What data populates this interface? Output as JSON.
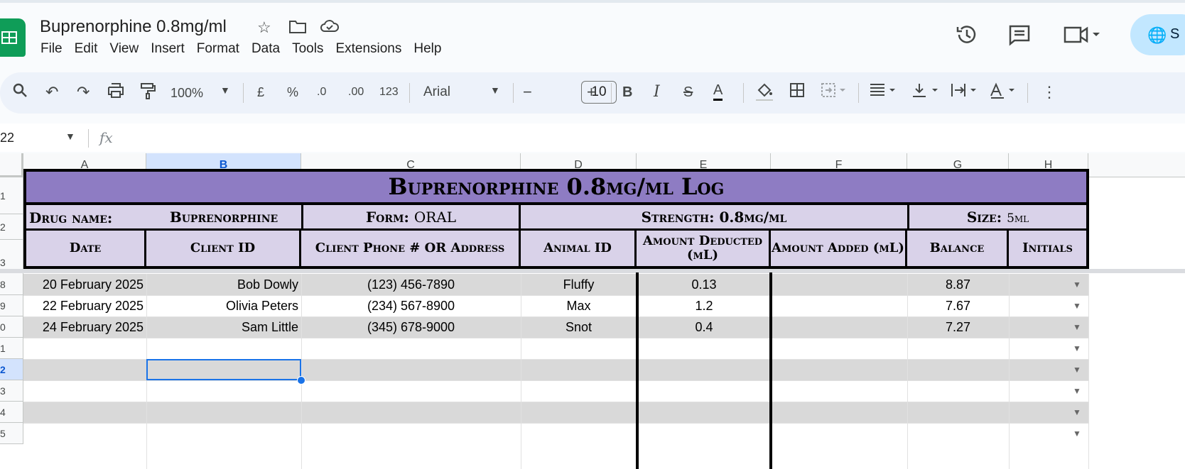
{
  "app": {
    "doc_title": "Buprenorphine 0.8mg/ml",
    "menu": [
      "File",
      "Edit",
      "View",
      "Insert",
      "Format",
      "Data",
      "Tools",
      "Extensions",
      "Help"
    ],
    "share_label": "S"
  },
  "toolbar": {
    "zoom": "100%",
    "currency": "£",
    "percent": "%",
    "dec_decrease": ".0",
    "dec_increase": ".00",
    "number_format": "123",
    "font": "Arial",
    "font_size": "10",
    "minus": "−",
    "plus": "+"
  },
  "formula_bar": {
    "name_box": "22",
    "fx": "fx",
    "value": ""
  },
  "columns": [
    "A",
    "B",
    "C",
    "D",
    "E",
    "F",
    "G",
    "H"
  ],
  "row_numbers": [
    "1",
    "2",
    "3",
    "8",
    "9",
    "0",
    "1",
    "2",
    "3",
    "4",
    "5"
  ],
  "sheet": {
    "title": "Buprenorphine 0.8mg/ml Log",
    "drug_name_label": "Drug name:",
    "drug_name_value": "Buprenorphine",
    "form_label": "Form:",
    "form_value": "ORAL",
    "strength_label": "Strength:",
    "strength_value": "0.8mg/ml",
    "size_label": "Size:",
    "size_value": "5ml",
    "headers": [
      "Date",
      "Client ID",
      "Client Phone # OR Address",
      "Animal ID",
      "Amount Deducted (mL)",
      "Amount Added (mL)",
      "Balance",
      "Initials"
    ],
    "rows": [
      {
        "date": "20 February 2025",
        "client": "Bob Dowly",
        "phone": "(123) 456-7890",
        "animal": "Fluffy",
        "deducted": "0.13",
        "added": "",
        "balance": "8.87",
        "initials": ""
      },
      {
        "date": "22 February 2025",
        "client": "Olivia Peters",
        "phone": "(234) 567-8900",
        "animal": "Max",
        "deducted": "1.2",
        "added": "",
        "balance": "7.67",
        "initials": ""
      },
      {
        "date": "24 February 2025",
        "client": "Sam Little",
        "phone": "(345) 678-9000",
        "animal": "Snot",
        "deducted": "0.4",
        "added": "",
        "balance": "7.27",
        "initials": ""
      }
    ]
  }
}
